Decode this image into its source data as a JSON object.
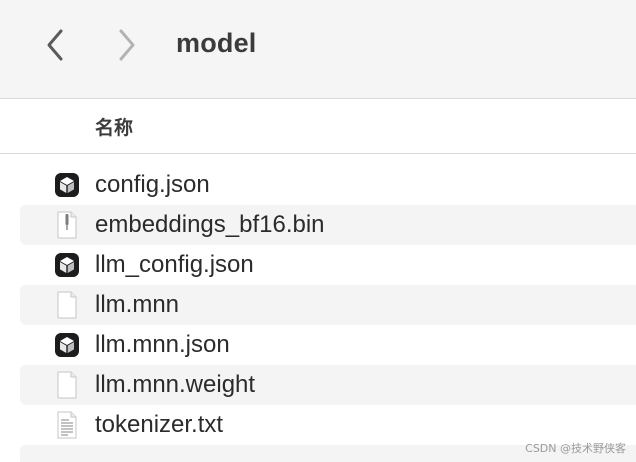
{
  "toolbar": {
    "back_icon": "chevron-left-icon",
    "forward_icon": "chevron-right-icon",
    "title": "model"
  },
  "columns": {
    "name": "名称"
  },
  "files": [
    {
      "name": "config.json",
      "icon": "json-document-icon"
    },
    {
      "name": "embeddings_bf16.bin",
      "icon": "binary-document-icon"
    },
    {
      "name": "llm_config.json",
      "icon": "json-document-icon"
    },
    {
      "name": "llm.mnn",
      "icon": "blank-document-icon"
    },
    {
      "name": "llm.mnn.json",
      "icon": "json-document-icon"
    },
    {
      "name": "llm.mnn.weight",
      "icon": "blank-document-icon"
    },
    {
      "name": "tokenizer.txt",
      "icon": "text-document-icon"
    }
  ],
  "watermark": "CSDN @技术野侠客",
  "colors": {
    "toolbar_bg": "#f5f5f5",
    "alt_row_bg": "#f4f4f4",
    "text": "#2b2b2b"
  }
}
